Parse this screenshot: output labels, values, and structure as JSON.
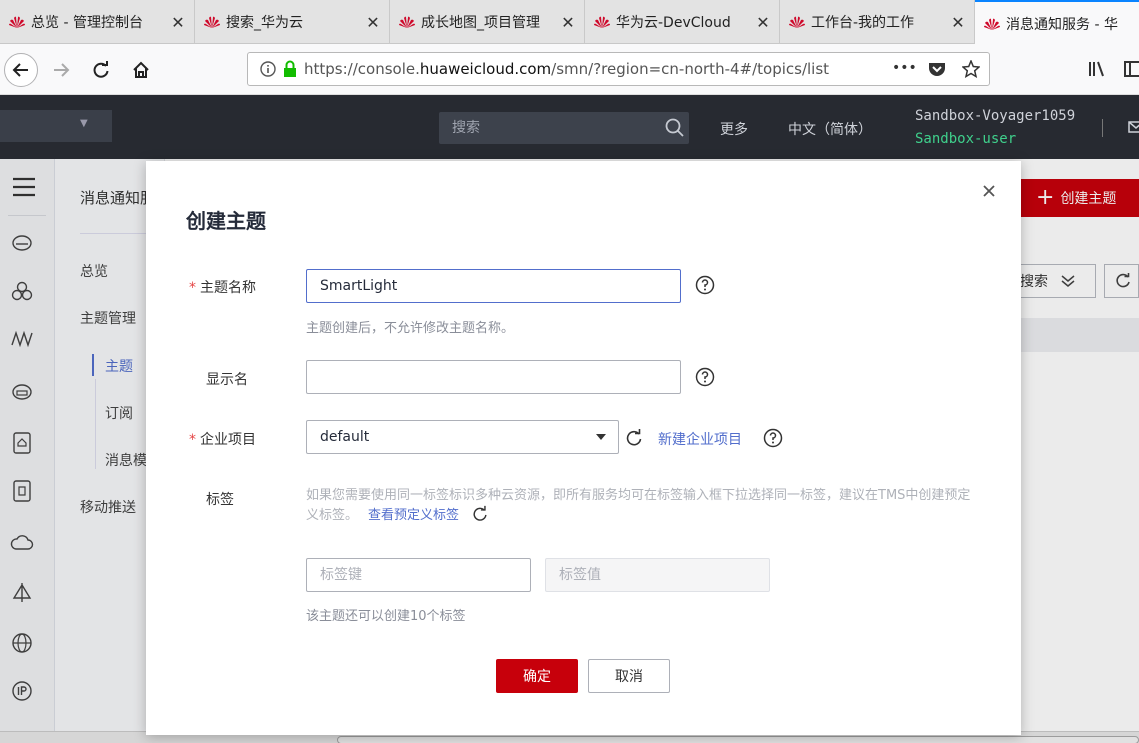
{
  "browser": {
    "tabs": [
      {
        "label": "总览 - 管理控制台"
      },
      {
        "label": "搜索_华为云"
      },
      {
        "label": "成长地图_项目管理"
      },
      {
        "label": "华为云-DevCloud"
      },
      {
        "label": "工作台-我的工作"
      },
      {
        "label": "消息通知服务 - 华"
      }
    ],
    "url_prefix": "https://console.",
    "url_domain": "huaweicloud.com",
    "url_suffix": "/smn/?region=cn-north-4#/topics/list",
    "more": "•••"
  },
  "topnav": {
    "search_placeholder": "搜索",
    "more": "更多",
    "language": "中文（简体）",
    "username": "Sandbox-Voyager1059",
    "subuser": "Sandbox-user"
  },
  "sidebar": {
    "title": "消息通知服务",
    "items": [
      {
        "label": "总览"
      },
      {
        "label": "主题管理"
      },
      {
        "label": "主题"
      },
      {
        "label": "订阅"
      },
      {
        "label": "消息模板"
      },
      {
        "label": "移动推送"
      }
    ]
  },
  "page": {
    "create_button": "创建主题",
    "search_button": "搜索"
  },
  "modal": {
    "title": "创建主题",
    "topic_name": {
      "label": "主题名称",
      "value": "SmartLight",
      "hint": "主题创建后，不允许修改主题名称。"
    },
    "display_name": {
      "label": "显示名",
      "value": ""
    },
    "enterprise_project": {
      "label": "企业项目",
      "value": "default",
      "new_link": "新建企业项目"
    },
    "tags": {
      "label": "标签",
      "desc": "如果您需要使用同一标签标识多种云资源，即所有服务均可在标签输入框下拉选择同一标签，建议在TMS中创建预定义标签。",
      "view_link": "查看预定义标签",
      "key_placeholder": "标签键",
      "value_placeholder": "标签值",
      "hint": "该主题还可以创建10个标签"
    },
    "ok_button": "确定",
    "cancel_button": "取消"
  },
  "colors": {
    "brand_red": "#c7000b",
    "link_blue": "#526ecc",
    "topnav_bg": "#272a31",
    "subuser_green": "#3fd08c"
  }
}
